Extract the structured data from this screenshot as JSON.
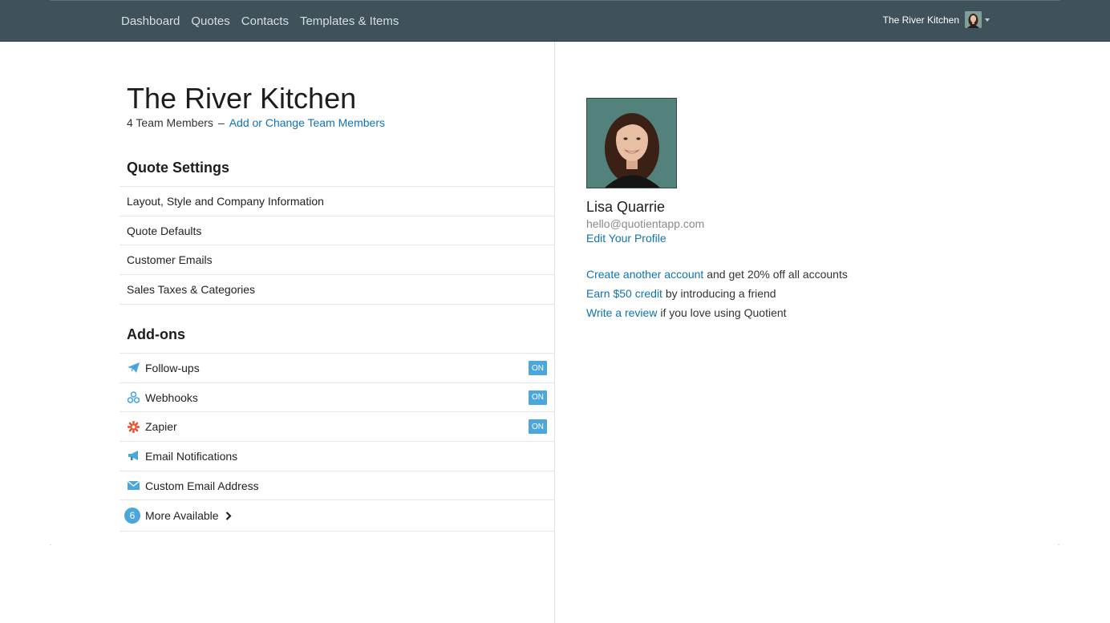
{
  "nav": {
    "items": [
      "Dashboard",
      "Quotes",
      "Contacts",
      "Templates & Items"
    ],
    "account_name": "The River Kitchen",
    "account_avatar_icon": "user-avatar",
    "account_caret_icon": "caret-down-icon"
  },
  "company": {
    "title": "The River Kitchen",
    "team_count": "4 Team Members",
    "dash": "–",
    "team_link": "Add or Change Team Members"
  },
  "quote_settings": {
    "heading": "Quote Settings",
    "items": [
      "Layout, Style and Company Information",
      "Quote Defaults",
      "Customer Emails",
      "Sales Taxes & Categories"
    ]
  },
  "addons": {
    "heading": "Add-ons",
    "items": [
      {
        "label": "Follow-ups",
        "icon": "paper-plane-icon",
        "status": "ON"
      },
      {
        "label": "Webhooks",
        "icon": "webhook-icon",
        "status": "ON"
      },
      {
        "label": "Zapier",
        "icon": "zapier-icon",
        "status": "ON"
      },
      {
        "label": "Email Notifications",
        "icon": "megaphone-icon",
        "status": ""
      },
      {
        "label": "Custom Email Address",
        "icon": "envelope-icon",
        "status": ""
      }
    ],
    "more_count": "6",
    "more_label": "More Available"
  },
  "profile": {
    "name": "Lisa Quarrie",
    "email": "hello@quotientapp.com",
    "edit_link": "Edit Your Profile"
  },
  "promos": [
    {
      "link": "Create another account",
      "text": " and get 20% off all accounts"
    },
    {
      "link": "Earn $50 credit",
      "text": " by introducing a friend"
    },
    {
      "link": "Write a review",
      "text": " if you love using Quotient"
    }
  ],
  "colors": {
    "topbar": "#3f525c",
    "link": "#0f73b6",
    "badge": "#4aa6dd",
    "zapier": "#ef4a23"
  }
}
